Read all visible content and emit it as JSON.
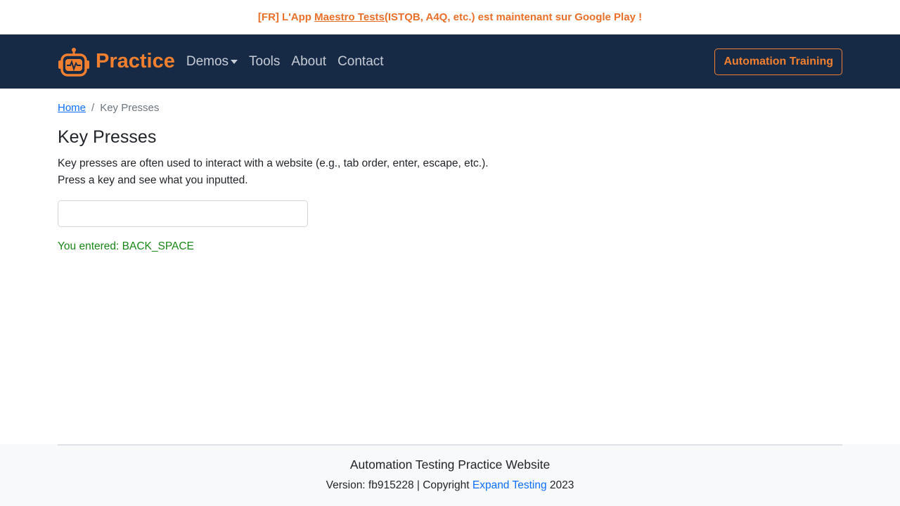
{
  "banner": {
    "prefix": "[FR] L'App ",
    "link": "Maestro Tests",
    "suffix": " (ISTQB, A4Q, etc.) est maintenant sur Google Play !"
  },
  "navbar": {
    "brand": "Practice",
    "links": [
      "Demos",
      "Tools",
      "About",
      "Contact"
    ],
    "cta": "Automation Training"
  },
  "breadcrumb": {
    "home": "Home",
    "separator": "/",
    "current": "Key Presses"
  },
  "main": {
    "title": "Key Presses",
    "description_line1": "Key presses are often used to interact with a website (e.g., tab order, enter, escape, etc.).",
    "description_line2": "Press a key and see what you inputted.",
    "input_value": "",
    "result": "You entered: BACK_SPACE"
  },
  "footer": {
    "title": "Automation Testing Practice Website",
    "version_prefix": "Version: fb915228 | Copyright ",
    "company": "Expand Testing",
    "year": " 2023"
  },
  "colors": {
    "accent": "#f0802f",
    "navbar_bg": "#172a45",
    "success": "#198718",
    "link": "#0d6efd"
  }
}
